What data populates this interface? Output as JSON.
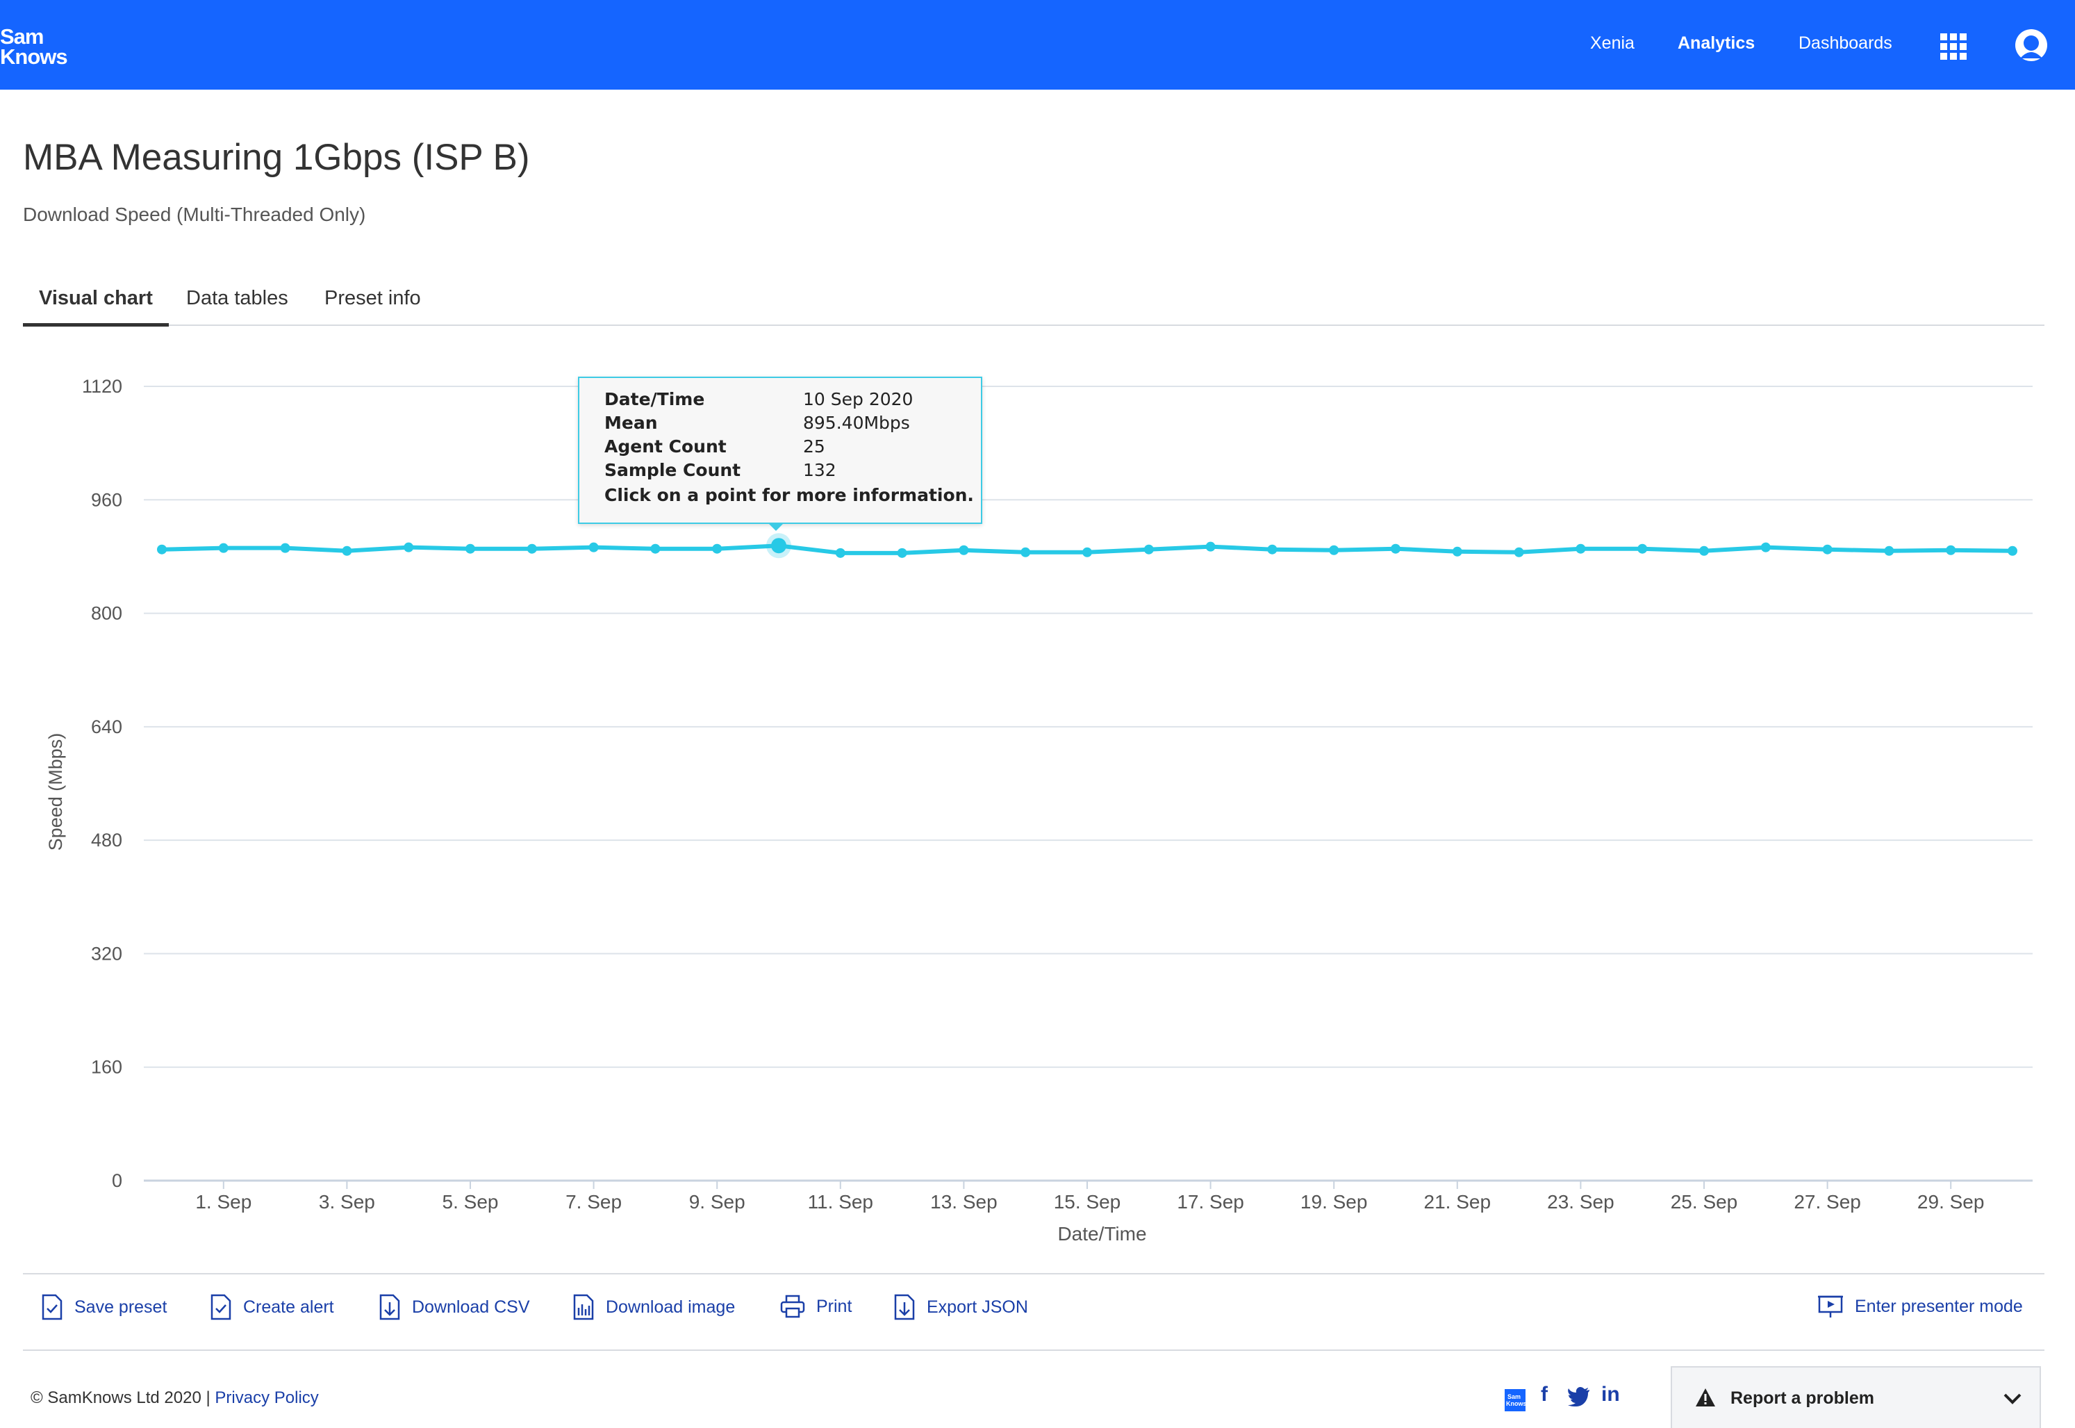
{
  "header": {
    "logo_line1": "Sam",
    "logo_line2": "Knows",
    "nav": [
      {
        "label": "Xenia",
        "active": false
      },
      {
        "label": "Analytics",
        "active": true
      },
      {
        "label": "Dashboards",
        "active": false
      }
    ],
    "apps_icon": "grid-icon",
    "user_icon": "user-icon",
    "bg_color": "#1565ff"
  },
  "page": {
    "title": "MBA Measuring 1Gbps (ISP B)",
    "subtitle": "Download Speed (Multi-Threaded Only)"
  },
  "tabs": [
    {
      "label": "Visual chart",
      "active": true
    },
    {
      "label": "Data tables",
      "active": false
    },
    {
      "label": "Preset info",
      "active": false
    }
  ],
  "tooltip": {
    "rows": [
      {
        "label": "Date/Time",
        "value": "10 Sep 2020"
      },
      {
        "label": "Mean",
        "value": "895.40Mbps"
      },
      {
        "label": "Agent Count",
        "value": "25"
      },
      {
        "label": "Sample Count",
        "value": "132"
      }
    ],
    "note": "Click on a point for more information."
  },
  "chart_data": {
    "type": "line",
    "xlabel": "Date/Time",
    "ylabel": "Speed (Mbps)",
    "ylim": [
      0,
      1120
    ],
    "yticks": [
      0,
      160,
      320,
      480,
      640,
      800,
      960,
      1120
    ],
    "xtick_labels": [
      "1. Sep",
      "3. Sep",
      "5. Sep",
      "7. Sep",
      "9. Sep",
      "11. Sep",
      "13. Sep",
      "15. Sep",
      "17. Sep",
      "19. Sep",
      "21. Sep",
      "23. Sep",
      "25. Sep",
      "27. Sep",
      "29. Sep"
    ],
    "grid": true,
    "line_color": "#27c9e6",
    "highlighted_index": 10,
    "x": [
      "2020-08-31",
      "2020-09-01",
      "2020-09-02",
      "2020-09-03",
      "2020-09-04",
      "2020-09-05",
      "2020-09-06",
      "2020-09-07",
      "2020-09-08",
      "2020-09-09",
      "2020-09-10",
      "2020-09-11",
      "2020-09-12",
      "2020-09-13",
      "2020-09-14",
      "2020-09-15",
      "2020-09-16",
      "2020-09-17",
      "2020-09-18",
      "2020-09-19",
      "2020-09-20",
      "2020-09-21",
      "2020-09-22",
      "2020-09-23",
      "2020-09-24",
      "2020-09-25",
      "2020-09-26",
      "2020-09-27",
      "2020-09-28",
      "2020-09-29",
      "2020-09-30"
    ],
    "series": [
      {
        "values": [
          890,
          892,
          892,
          888,
          893,
          891,
          891,
          893,
          891,
          891,
          895.4,
          885,
          885,
          889,
          886,
          886,
          890,
          894,
          890,
          889,
          891,
          887,
          886,
          891,
          891,
          888,
          893,
          890,
          888,
          889,
          888
        ]
      }
    ]
  },
  "actions": [
    {
      "label": "Save preset",
      "icon": "save-preset-icon"
    },
    {
      "label": "Create alert",
      "icon": "create-alert-icon"
    },
    {
      "label": "Download CSV",
      "icon": "download-csv-icon"
    },
    {
      "label": "Download image",
      "icon": "download-image-icon"
    },
    {
      "label": "Print",
      "icon": "print-icon"
    },
    {
      "label": "Export JSON",
      "icon": "export-json-icon"
    },
    {
      "label": "Enter presenter mode",
      "icon": "presenter-mode-icon"
    }
  ],
  "footer": {
    "copyright": "© SamKnows Ltd 2020  |",
    "privacy_link": "Privacy Policy",
    "social_icons": [
      "samknows-icon",
      "facebook-icon",
      "twitter-icon",
      "linkedin-icon"
    ],
    "facebook_glyph": "f",
    "linkedin_glyph": "in",
    "report_label": "Report a problem"
  }
}
